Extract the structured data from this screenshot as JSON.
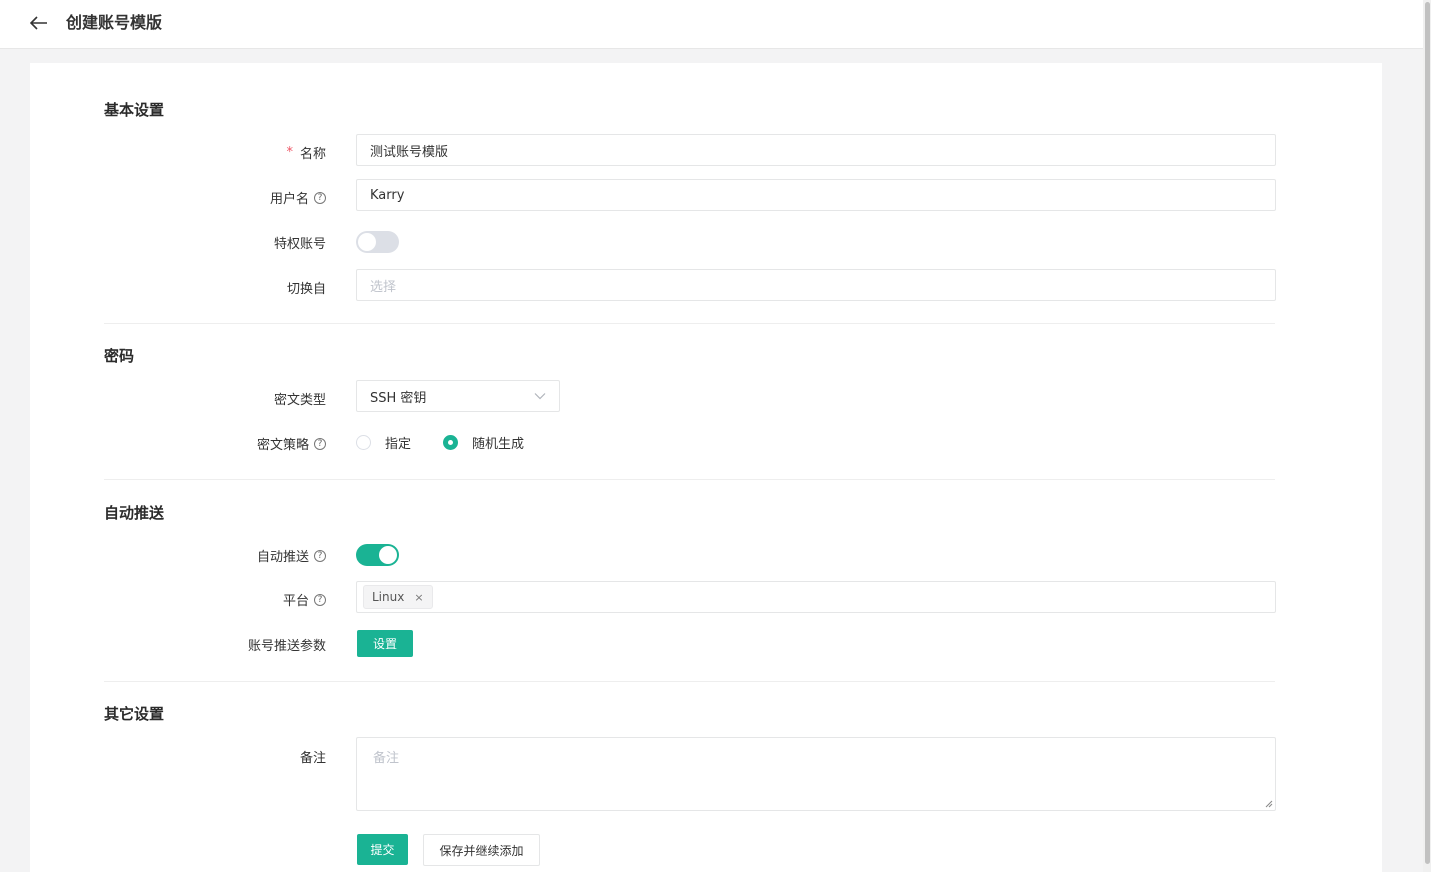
{
  "header": {
    "title": "创建账号模版"
  },
  "sections": {
    "basic": {
      "title": "基本设置"
    },
    "password": {
      "title": "密码"
    },
    "auto_push": {
      "title": "自动推送"
    },
    "other": {
      "title": "其它设置"
    }
  },
  "fields": {
    "name": {
      "label": "名称",
      "required_mark": "*",
      "value": "测试账号模版"
    },
    "username": {
      "label": "用户名",
      "value": "Karry"
    },
    "privileged": {
      "label": "特权账号",
      "on": false
    },
    "su_from": {
      "label": "切换自",
      "placeholder": "选择"
    },
    "secret_type": {
      "label": "密文类型",
      "value": "SSH 密钥"
    },
    "secret_strategy": {
      "label": "密文策略",
      "options": [
        "指定",
        "随机生成"
      ],
      "selected": "随机生成"
    },
    "push_now": {
      "label": "自动推送",
      "on": true
    },
    "platforms": {
      "label": "平台",
      "tags": [
        "Linux"
      ]
    },
    "push_params": {
      "label": "账号推送参数",
      "button": "设置"
    },
    "comment": {
      "label": "备注",
      "placeholder": "备注"
    }
  },
  "help_icon": "?",
  "close_glyph": "×",
  "actions": {
    "submit": "提交",
    "save_continue": "保存并继续添加"
  },
  "colors": {
    "accent": "#1ab394",
    "required": "#ed5565"
  }
}
